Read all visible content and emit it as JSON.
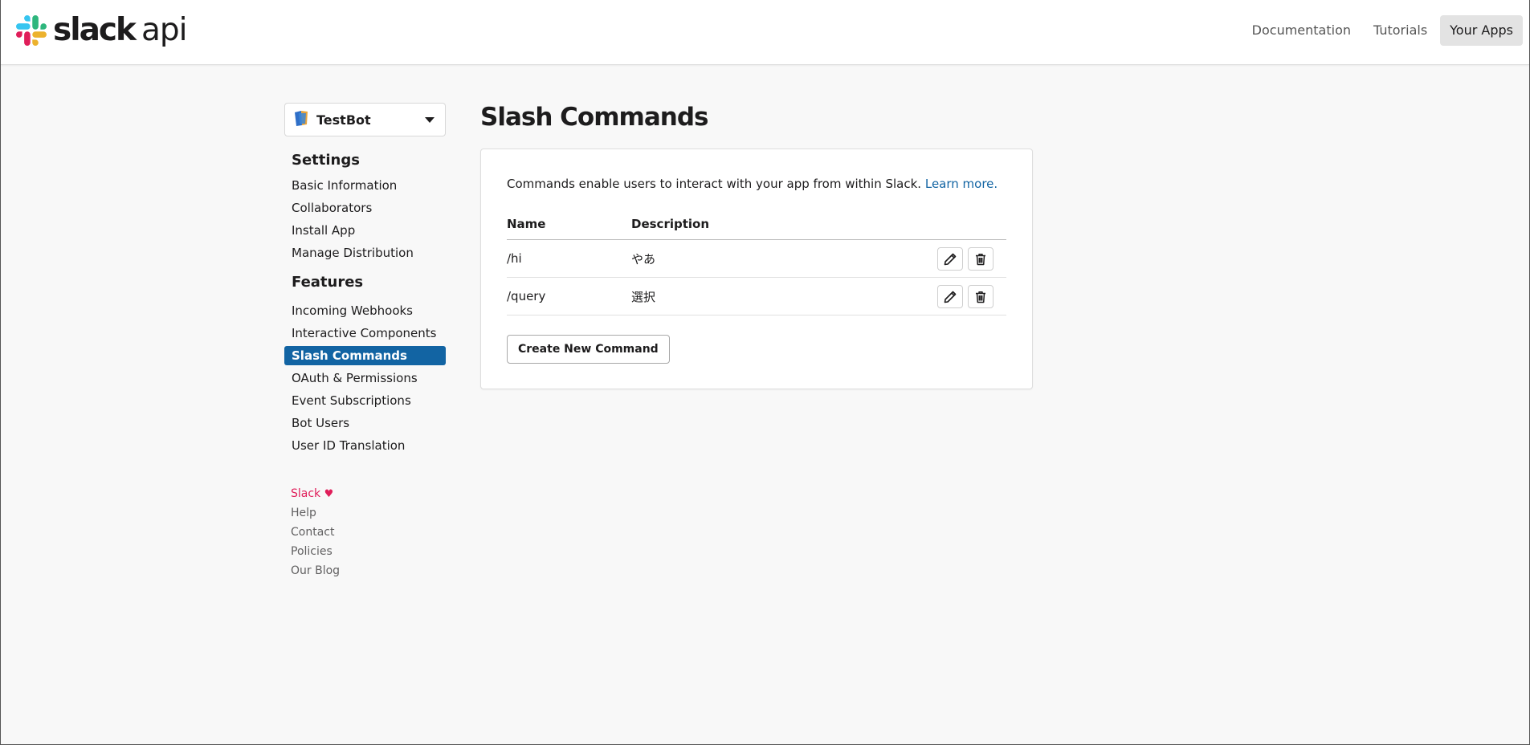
{
  "header": {
    "logo_word": "slack",
    "logo_suffix": "api",
    "nav": [
      {
        "label": "Documentation",
        "active": false
      },
      {
        "label": "Tutorials",
        "active": false
      },
      {
        "label": "Your Apps",
        "active": true
      }
    ]
  },
  "sidebar": {
    "app_name": "TestBot",
    "settings_heading": "Settings",
    "settings_items": [
      {
        "label": "Basic Information"
      },
      {
        "label": "Collaborators"
      },
      {
        "label": "Install App"
      },
      {
        "label": "Manage Distribution"
      }
    ],
    "features_heading": "Features",
    "features_items": [
      {
        "label": "Incoming Webhooks"
      },
      {
        "label": "Interactive Components"
      },
      {
        "label": "Slash Commands",
        "active": true
      },
      {
        "label": "OAuth & Permissions"
      },
      {
        "label": "Event Subscriptions"
      },
      {
        "label": "Bot Users"
      },
      {
        "label": "User ID Translation"
      }
    ],
    "footer": {
      "brand": "Slack",
      "heart": "♥",
      "links": [
        "Help",
        "Contact",
        "Policies",
        "Our Blog"
      ]
    }
  },
  "main": {
    "title": "Slash Commands",
    "intro_text": "Commands enable users to interact with your app from within Slack.",
    "learn_more": "Learn more.",
    "table": {
      "columns": [
        "Name",
        "Description"
      ],
      "rows": [
        {
          "name": "/hi",
          "description": "やあ"
        },
        {
          "name": "/query",
          "description": "選択"
        }
      ]
    },
    "create_button": "Create New Command"
  },
  "colors": {
    "accent": "#1264a3",
    "page_bg": "#f8f8f8",
    "brand_red": "#e01e5a"
  },
  "icons": {
    "edit": "pencil-icon",
    "delete": "trash-icon",
    "dropdown": "caret-down-icon",
    "app": "app-icon",
    "logo": "slack-logo-icon"
  }
}
